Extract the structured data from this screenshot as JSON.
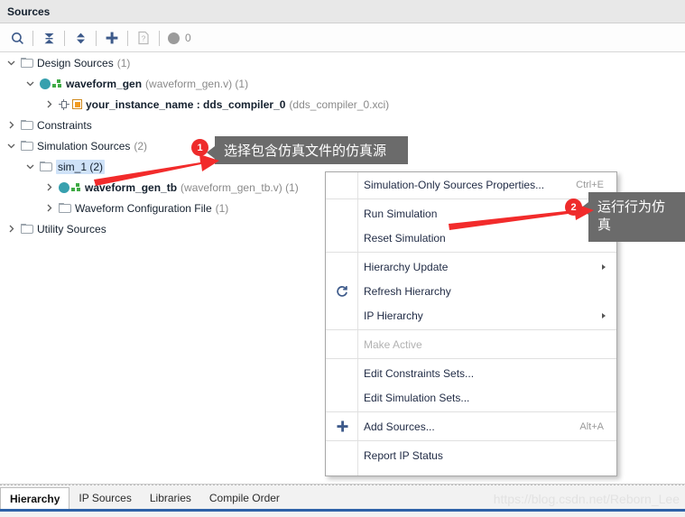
{
  "panel": {
    "title": "Sources"
  },
  "toolbar": {
    "buttons": [
      {
        "name": "search-icon",
        "label": "Search"
      },
      {
        "name": "collapse-all-icon",
        "label": "Collapse All"
      },
      {
        "name": "expand-all-icon",
        "label": "Expand All"
      },
      {
        "name": "add-sources-icon",
        "label": "Add Sources"
      },
      {
        "name": "report-icon",
        "label": "Report"
      }
    ],
    "count_label": "0"
  },
  "tree": {
    "rows": [
      {
        "id": "design-sources",
        "indent": 0,
        "twisty": "down",
        "icon": "folder-icon",
        "label": "Design Sources",
        "suffix": "(1)",
        "bold": false,
        "selected": false
      },
      {
        "id": "waveform-gen",
        "indent": 1,
        "twisty": "down",
        "icon": "module-icon",
        "label": "waveform_gen",
        "suffix": "(waveform_gen.v) (1)",
        "bold": true,
        "selected": false
      },
      {
        "id": "your-instance-name",
        "indent": 2,
        "twisty": "right",
        "icon": "ip-icon",
        "label": "your_instance_name : dds_compiler_0",
        "suffix": "(dds_compiler_0.xci)",
        "bold": true,
        "selected": false
      },
      {
        "id": "constraints",
        "indent": 0,
        "twisty": "right",
        "icon": "folder-icon",
        "label": "Constraints",
        "suffix": "",
        "bold": false,
        "selected": false
      },
      {
        "id": "simulation-sources",
        "indent": 0,
        "twisty": "down",
        "icon": "folder-icon",
        "label": "Simulation Sources",
        "suffix": "(2)",
        "bold": false,
        "selected": false
      },
      {
        "id": "sim-1",
        "indent": 1,
        "twisty": "down",
        "icon": "folder-icon",
        "label": "sim_1 (2)",
        "suffix": "",
        "bold": false,
        "selected": true
      },
      {
        "id": "waveform-gen-tb",
        "indent": 2,
        "twisty": "right",
        "icon": "module-icon",
        "label": "waveform_gen_tb",
        "suffix": "(waveform_gen_tb.v) (1)",
        "bold": true,
        "selected": false
      },
      {
        "id": "waveform-configuration-file",
        "indent": 2,
        "twisty": "right",
        "icon": "folder-icon",
        "label": "Waveform Configuration File",
        "suffix": "(1)",
        "bold": false,
        "selected": false
      },
      {
        "id": "utility-sources",
        "indent": 0,
        "twisty": "right",
        "icon": "folder-icon",
        "label": "Utility Sources",
        "suffix": "",
        "bold": false,
        "selected": false
      }
    ]
  },
  "context_menu": {
    "items": [
      {
        "label": "Simulation-Only Sources Properties...",
        "accel": "Ctrl+E",
        "submenu": false,
        "disabled": false,
        "icon": "",
        "sep_after": true
      },
      {
        "label": "Run Simulation",
        "accel": "",
        "submenu": true,
        "disabled": false,
        "icon": "",
        "sep_after": false
      },
      {
        "label": "Reset Simulation",
        "accel": "",
        "submenu": true,
        "disabled": false,
        "icon": "",
        "sep_after": true
      },
      {
        "label": "Hierarchy Update",
        "accel": "",
        "submenu": true,
        "disabled": false,
        "icon": "",
        "sep_after": false
      },
      {
        "label": "Refresh Hierarchy",
        "accel": "",
        "submenu": false,
        "disabled": false,
        "icon": "refresh-icon",
        "sep_after": false
      },
      {
        "label": "IP Hierarchy",
        "accel": "",
        "submenu": true,
        "disabled": false,
        "icon": "",
        "sep_after": true
      },
      {
        "label": "Make Active",
        "accel": "",
        "submenu": false,
        "disabled": true,
        "icon": "",
        "sep_after": true
      },
      {
        "label": "Edit Constraints Sets...",
        "accel": "",
        "submenu": false,
        "disabled": false,
        "icon": "",
        "sep_after": false
      },
      {
        "label": "Edit Simulation Sets...",
        "accel": "",
        "submenu": false,
        "disabled": false,
        "icon": "",
        "sep_after": true
      },
      {
        "label": "Add Sources...",
        "accel": "Alt+A",
        "submenu": false,
        "disabled": false,
        "icon": "plus-icon",
        "sep_after": true
      },
      {
        "label": "Report IP Status",
        "accel": "",
        "submenu": false,
        "disabled": false,
        "icon": "",
        "sep_after": false
      }
    ]
  },
  "annotations": [
    {
      "id": "callout-1",
      "number": "1",
      "text": "选择包含仿真文件的仿真源"
    },
    {
      "id": "callout-2",
      "number": "2",
      "text": "运行行为仿真"
    }
  ],
  "bottom_tabs": {
    "tabs": [
      {
        "label": "Hierarchy",
        "active": true
      },
      {
        "label": "IP Sources",
        "active": false
      },
      {
        "label": "Libraries",
        "active": false
      },
      {
        "label": "Compile Order",
        "active": false
      }
    ],
    "watermark": "https://blog.csdn.net/Reborn_Lee"
  },
  "colors": {
    "accent": "#2d62a8",
    "selection": "#cfe2f8",
    "annotation_bg": "#6b6b6b",
    "annotation_marker": "#ee2b2b",
    "module_icon": "#37a0ae"
  }
}
